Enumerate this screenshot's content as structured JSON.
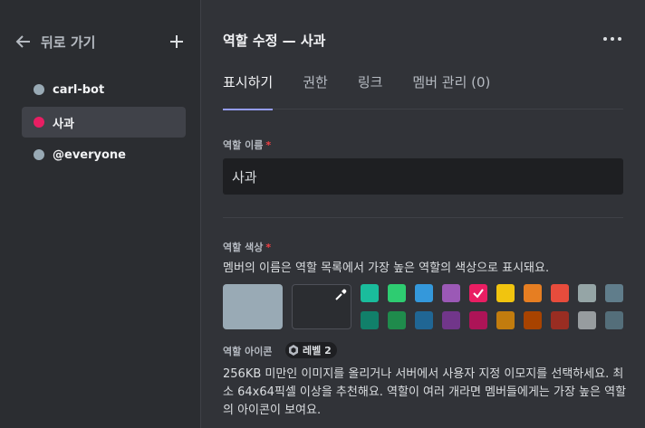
{
  "sidebar": {
    "back_label": "뒤로 가기",
    "roles": [
      {
        "name": "carl-bot",
        "color": "#99aab5"
      },
      {
        "name": "사과",
        "color": "#e91e63"
      },
      {
        "name": "@everyone",
        "color": "#99aab5"
      }
    ]
  },
  "header": {
    "title": "역할 수정 — 사과"
  },
  "tabs": [
    "표시하기",
    "권한",
    "링크",
    "멤버 관리 (0)"
  ],
  "role_name": {
    "label": "역할 이름",
    "required_mark": "*",
    "value": "사과"
  },
  "role_color": {
    "label": "역할 색상",
    "required_mark": "*",
    "description": "멤버의 이름은 역할 목록에서 가장 높은 역할의 색상으로 표시돼요.",
    "default_color": "#99aab5",
    "selected_color": "#e91e63",
    "palette_top": [
      "#1abc9c",
      "#2ecc71",
      "#3498db",
      "#9b59b6",
      "#e91e63",
      "#f1c40f",
      "#e67e22",
      "#e74c3c",
      "#95a5a6",
      "#607d8b"
    ],
    "palette_bottom": [
      "#11806a",
      "#1f8b4c",
      "#206694",
      "#71368a",
      "#ad1457",
      "#c27c0e",
      "#a84300",
      "#992d22",
      "#979c9f",
      "#546e7a"
    ]
  },
  "role_icon": {
    "label": "역할 아이콘",
    "level_badge": "레벨 2",
    "description": "256KB 미만인 이미지를 올리거나 서버에서 사용자 지정 이모지를 선택하세요. 최소 64x64픽셀 이상을 추천해요. 역할이 여러 개라면 멤버들에게는 가장 높은 역할의 아이콘이 보여요."
  }
}
